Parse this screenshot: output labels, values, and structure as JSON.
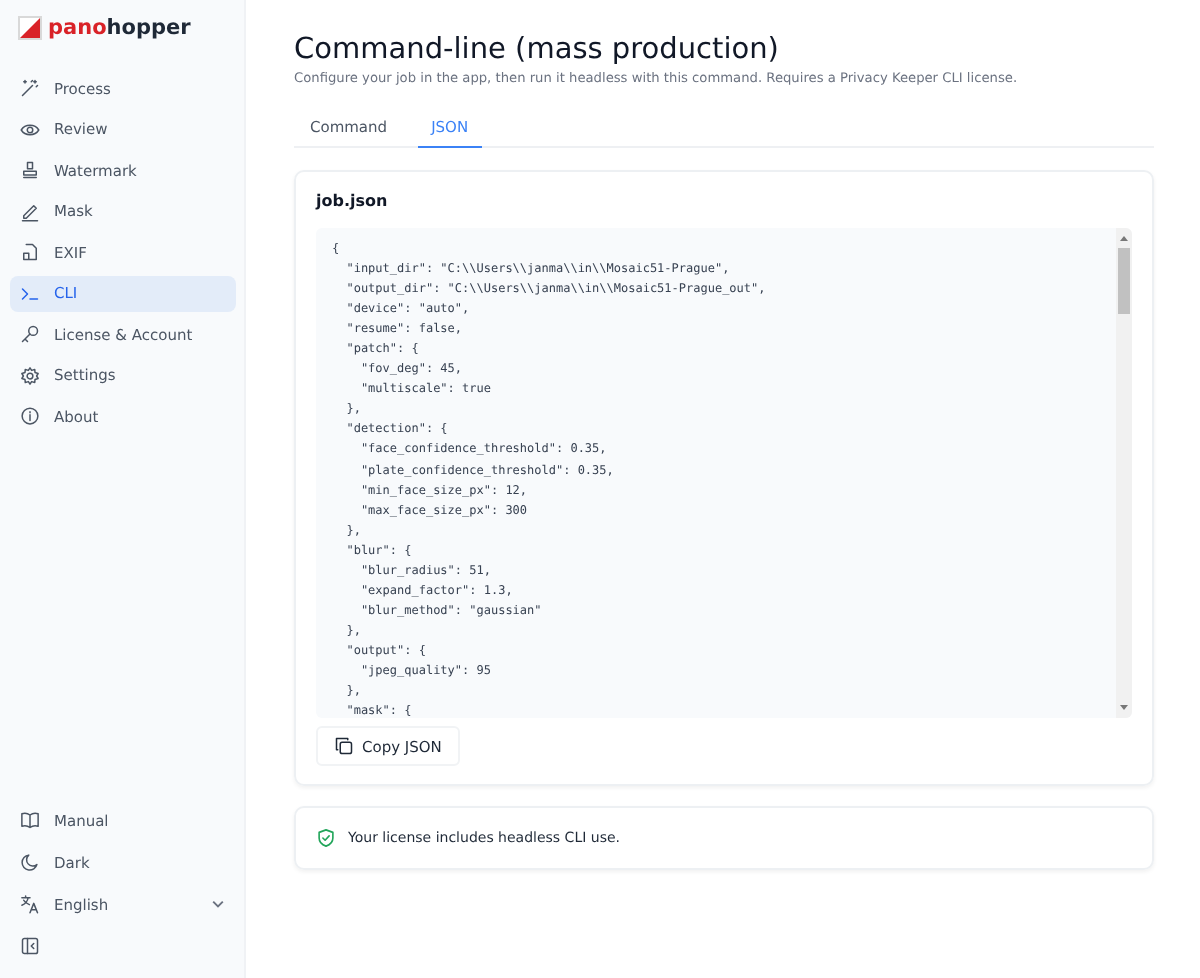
{
  "brand": {
    "prefix": "pano",
    "suffix": "hopper"
  },
  "nav": [
    {
      "label": "Process",
      "selected": false
    },
    {
      "label": "Review",
      "selected": false
    },
    {
      "label": "Watermark",
      "selected": false
    },
    {
      "label": "Mask",
      "selected": false
    },
    {
      "label": "EXIF",
      "selected": false
    },
    {
      "label": "CLI",
      "selected": true
    },
    {
      "label": "License & Account",
      "selected": false
    },
    {
      "label": "Settings",
      "selected": false
    },
    {
      "label": "About",
      "selected": false
    }
  ],
  "sidebar_footer": {
    "manual": "Manual",
    "theme": "Dark",
    "language": "English"
  },
  "page": {
    "title": "Command-line (mass production)",
    "subtitle": "Configure your job in the app, then run it headless with this command. Requires a Privacy Keeper CLI license."
  },
  "tabs": [
    {
      "label": "Command",
      "selected": false
    },
    {
      "label": "JSON",
      "selected": true
    }
  ],
  "card": {
    "title": "job.json",
    "code_lines": [
      "{",
      "  \"input_dir\": \"C:\\\\Users\\\\janma\\\\in\\\\Mosaic51-Prague\",",
      "  \"output_dir\": \"C:\\\\Users\\\\janma\\\\in\\\\Mosaic51-Prague_out\",",
      "  \"device\": \"auto\",",
      "  \"resume\": false,",
      "  \"patch\": {",
      "    \"fov_deg\": 45,",
      "    \"multiscale\": true",
      "  },",
      "  \"detection\": {",
      "    \"face_confidence_threshold\": 0.35,",
      "    \"plate_confidence_threshold\": 0.35,",
      "    \"min_face_size_px\": 12,",
      "    \"max_face_size_px\": 300",
      "  },",
      "  \"blur\": {",
      "    \"blur_radius\": 51,",
      "    \"expand_factor\": 1.3,",
      "    \"blur_method\": \"gaussian\"",
      "  },",
      "  \"output\": {",
      "    \"jpeg_quality\": 95",
      "  },",
      "  \"mask\": {"
    ],
    "copy_button": "Copy JSON"
  },
  "license_notice": "Your license includes headless CLI use."
}
